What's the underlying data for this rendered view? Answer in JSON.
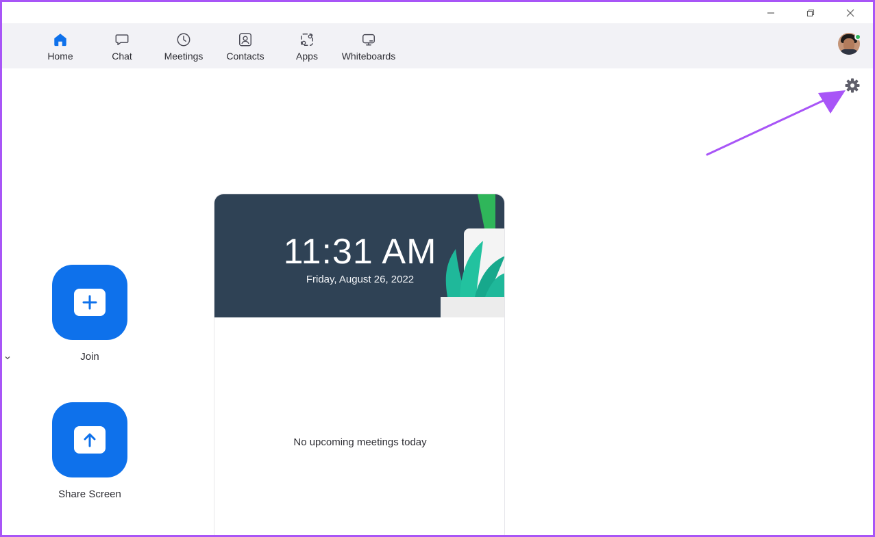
{
  "window": {
    "controls": {
      "minimize": "minimize-icon",
      "maximize": "restore-icon",
      "close": "close-icon"
    }
  },
  "nav": {
    "tabs": [
      {
        "id": "home",
        "label": "Home",
        "icon": "home-icon",
        "active": true
      },
      {
        "id": "chat",
        "label": "Chat",
        "icon": "chat-icon",
        "active": false
      },
      {
        "id": "meetings",
        "label": "Meetings",
        "icon": "clock-icon",
        "active": false
      },
      {
        "id": "contacts",
        "label": "Contacts",
        "icon": "contacts-icon",
        "active": false
      },
      {
        "id": "apps",
        "label": "Apps",
        "icon": "apps-icon",
        "active": false
      },
      {
        "id": "whiteboards",
        "label": "Whiteboards",
        "icon": "whiteboard-icon",
        "active": false
      }
    ],
    "profile": {
      "icon": "avatar",
      "status": "online",
      "status_color": "#2fb65a"
    }
  },
  "settings": {
    "icon": "gear-icon"
  },
  "actions": {
    "join_label": "Join",
    "share_label": "Share Screen"
  },
  "clock": {
    "time": "11:31 AM",
    "date": "Friday, August 26, 2022"
  },
  "meetings": {
    "empty_text": "No upcoming meetings today"
  },
  "colors": {
    "accent": "#0e71eb",
    "annotation": "#a855f7",
    "nav_bg": "#f2f2f6",
    "banner_bg": "#2f4255"
  }
}
